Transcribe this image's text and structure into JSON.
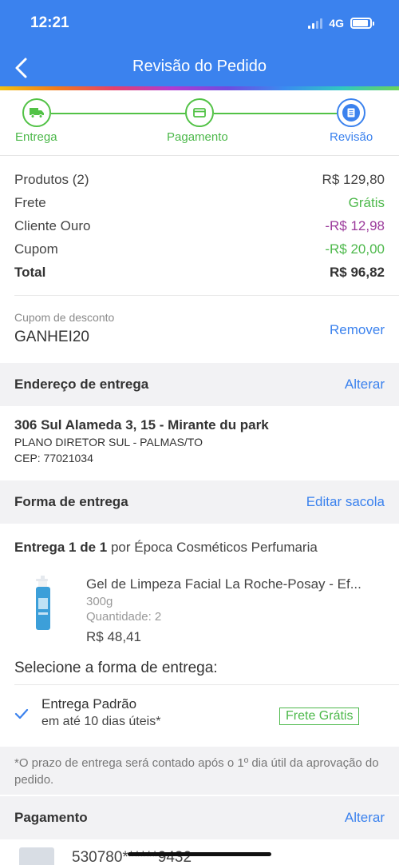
{
  "status_bar": {
    "time": "12:21",
    "network": "4G"
  },
  "header": {
    "title": "Revisão do Pedido"
  },
  "colors": {
    "primary": "#3b82ee",
    "success": "#4cb84a",
    "discount_purple": "#9b3a9b"
  },
  "stepper": {
    "steps": [
      {
        "label": "Entrega",
        "icon": "truck-icon",
        "state": "done"
      },
      {
        "label": "Pagamento",
        "icon": "card-icon",
        "state": "done"
      },
      {
        "label": "Revisão",
        "icon": "list-icon",
        "state": "current"
      }
    ]
  },
  "summary": {
    "rows": [
      {
        "label": "Produtos (2)",
        "value": "R$ 129,80"
      },
      {
        "label": "Frete",
        "value": "Grátis"
      },
      {
        "label": "Cliente Ouro",
        "value": "-R$ 12,98"
      },
      {
        "label": "Cupom",
        "value": "-R$ 20,00"
      },
      {
        "label": "Total",
        "value": "R$ 96,82"
      }
    ]
  },
  "coupon": {
    "label": "Cupom de desconto",
    "code": "GANHEI20",
    "action": "Remover"
  },
  "address_section": {
    "title": "Endereço de entrega",
    "action": "Alterar"
  },
  "address": {
    "line1": "306 Sul Alameda 3, 15 - Mirante du park",
    "line2": "PLANO DIRETOR SUL - PALMAS/TO",
    "line3": "CEP: 77021034"
  },
  "delivery_section": {
    "title": "Forma de entrega",
    "action": "Editar sacola"
  },
  "shipment": {
    "prefix": "Entrega 1 de 1",
    "suffix": " por Época Cosméticos Perfumaria"
  },
  "product": {
    "name": "Gel de Limpeza Facial La Roche-Posay - Ef...",
    "weight": "300g",
    "quantity": "Quantidade: 2",
    "price": "R$ 48,41"
  },
  "delivery_options": {
    "title": "Selecione a forma de entrega:",
    "selected": {
      "name": "Entrega Padrão",
      "time": "em até 10 dias úteis*",
      "badge": "Frete Grátis"
    }
  },
  "note": "*O prazo de entrega será contado após o 1º dia útil da aprovação do pedido.",
  "payment_section": {
    "title": "Pagamento",
    "action": "Alterar"
  },
  "payment": {
    "card_number": "530780******9432"
  }
}
